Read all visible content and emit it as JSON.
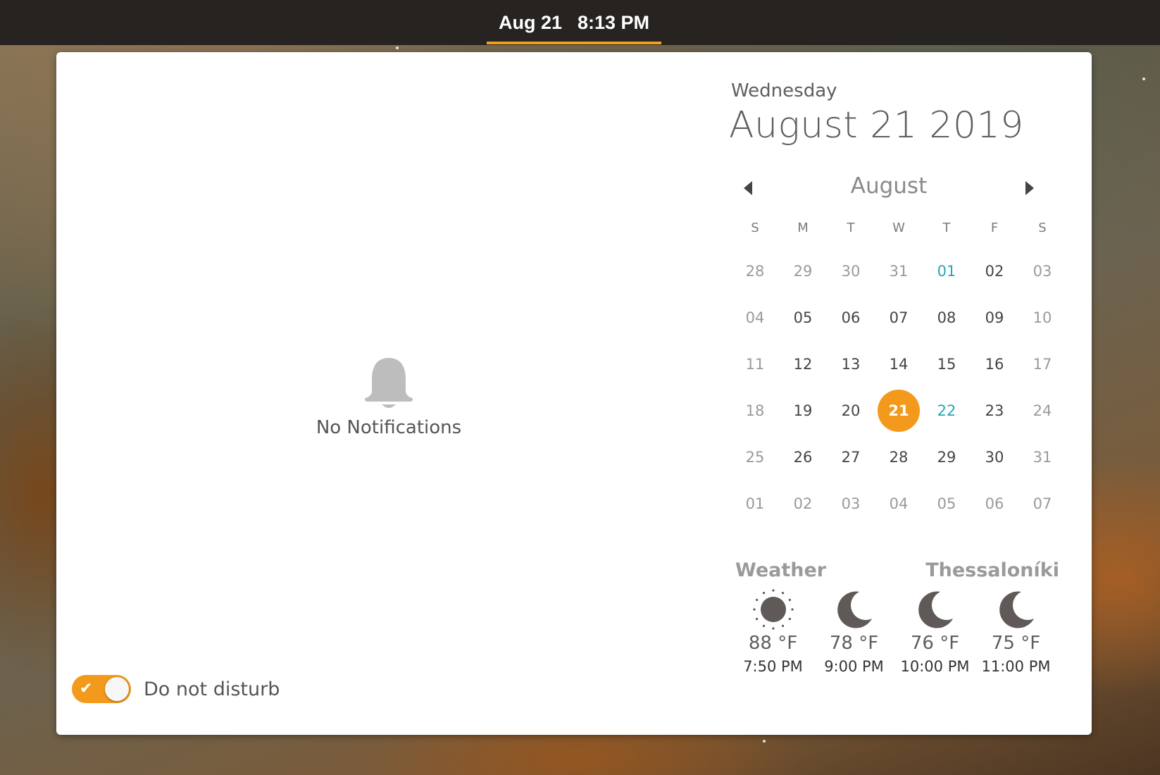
{
  "panel": {
    "clock_date": "Aug 21",
    "clock_time": "8:13 PM",
    "accent_color": "#f39a1c"
  },
  "notifications": {
    "empty_icon": "bell-icon",
    "empty_label": "No Notifications",
    "dnd_label": "Do not disturb",
    "dnd_enabled": true
  },
  "calendar": {
    "weekday": "Wednesday",
    "full_date": "August 21 2019",
    "month_label": "August",
    "prev_icon": "chevron-left-icon",
    "next_icon": "chevron-right-icon",
    "days_of_week": [
      "S",
      "M",
      "T",
      "W",
      "T",
      "F",
      "S"
    ],
    "weeks": [
      [
        {
          "d": "28",
          "s": "dim"
        },
        {
          "d": "29",
          "s": "dim"
        },
        {
          "d": "30",
          "s": "dim"
        },
        {
          "d": "31",
          "s": "dim"
        },
        {
          "d": "01",
          "s": "event"
        },
        {
          "d": "02",
          "s": ""
        },
        {
          "d": "03",
          "s": "dim"
        }
      ],
      [
        {
          "d": "04",
          "s": "dim"
        },
        {
          "d": "05",
          "s": ""
        },
        {
          "d": "06",
          "s": ""
        },
        {
          "d": "07",
          "s": ""
        },
        {
          "d": "08",
          "s": ""
        },
        {
          "d": "09",
          "s": ""
        },
        {
          "d": "10",
          "s": "dim"
        }
      ],
      [
        {
          "d": "11",
          "s": "dim"
        },
        {
          "d": "12",
          "s": ""
        },
        {
          "d": "13",
          "s": ""
        },
        {
          "d": "14",
          "s": ""
        },
        {
          "d": "15",
          "s": ""
        },
        {
          "d": "16",
          "s": ""
        },
        {
          "d": "17",
          "s": "dim"
        }
      ],
      [
        {
          "d": "18",
          "s": "dim"
        },
        {
          "d": "19",
          "s": ""
        },
        {
          "d": "20",
          "s": ""
        },
        {
          "d": "21",
          "s": "today"
        },
        {
          "d": "22",
          "s": "event"
        },
        {
          "d": "23",
          "s": ""
        },
        {
          "d": "24",
          "s": "dim"
        }
      ],
      [
        {
          "d": "25",
          "s": "dim"
        },
        {
          "d": "26",
          "s": ""
        },
        {
          "d": "27",
          "s": ""
        },
        {
          "d": "28",
          "s": ""
        },
        {
          "d": "29",
          "s": ""
        },
        {
          "d": "30",
          "s": ""
        },
        {
          "d": "31",
          "s": "dim"
        }
      ],
      [
        {
          "d": "01",
          "s": "dim"
        },
        {
          "d": "02",
          "s": "dim"
        },
        {
          "d": "03",
          "s": "dim"
        },
        {
          "d": "04",
          "s": "dim"
        },
        {
          "d": "05",
          "s": "dim"
        },
        {
          "d": "06",
          "s": "dim"
        },
        {
          "d": "07",
          "s": "dim"
        }
      ]
    ]
  },
  "weather": {
    "title": "Weather",
    "city": "Thessaloníki",
    "forecast": [
      {
        "icon": "sun-icon",
        "temp": "88 °F",
        "time": "7:50 PM"
      },
      {
        "icon": "moon-icon",
        "temp": "78 °F",
        "time": "9:00 PM"
      },
      {
        "icon": "moon-icon",
        "temp": "76 °F",
        "time": "10:00 PM"
      },
      {
        "icon": "moon-icon",
        "temp": "75 °F",
        "time": "11:00 PM"
      }
    ]
  }
}
